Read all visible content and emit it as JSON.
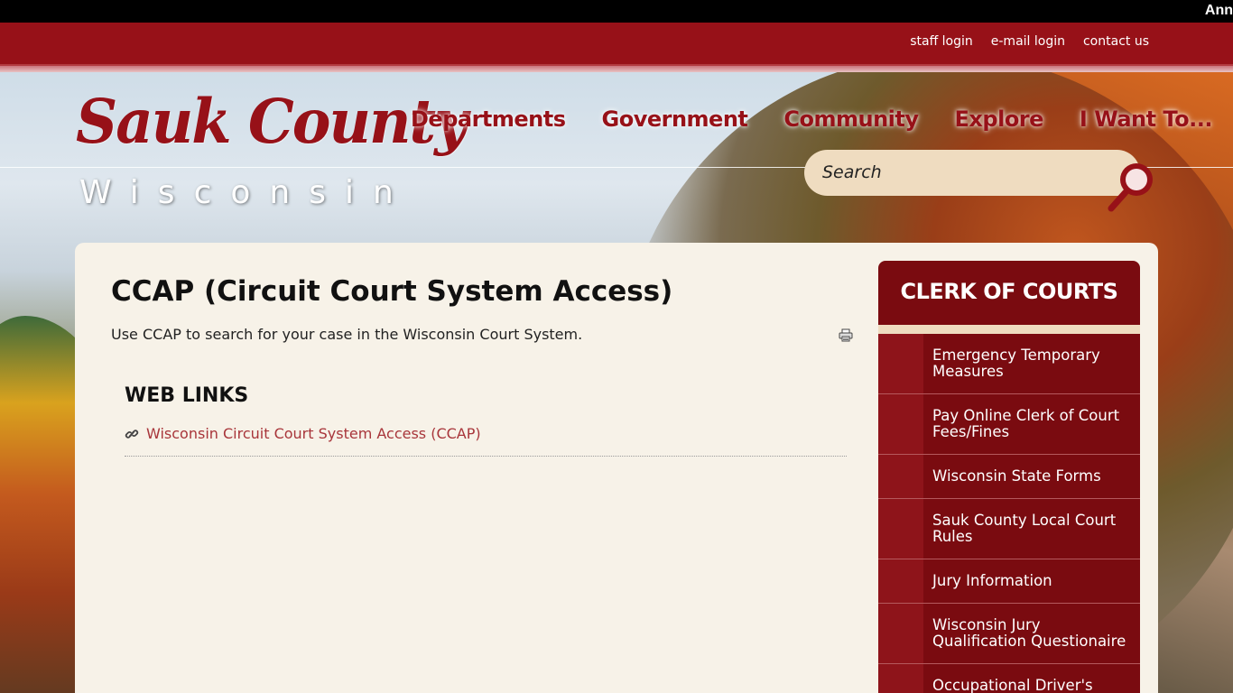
{
  "topbar": {
    "announcement": "Ann"
  },
  "utility": {
    "links": [
      "staff login",
      "e-mail login",
      "contact us"
    ]
  },
  "logo": {
    "main": "Sauk County",
    "sub": "Wisconsin"
  },
  "nav": {
    "items": [
      "Departments",
      "Government",
      "Community",
      "Explore",
      "I Want To..."
    ]
  },
  "search": {
    "placeholder": "Search"
  },
  "page": {
    "title": "CCAP (Circuit Court System Access)",
    "intro": "Use CCAP to search for your case in the Wisconsin Court System.",
    "weblinks_title": "WEB LINKS",
    "weblink": "Wisconsin Circuit Court System Access (CCAP)"
  },
  "sidebar": {
    "title": "CLERK OF COURTS",
    "items": [
      "Emergency Temporary Measures",
      "Pay Online Clerk of Court Fees/Fines",
      "Wisconsin State Forms",
      "Sauk County Local Court Rules",
      "Jury Information",
      "Wisconsin Jury Qualification Questionaire",
      "Occupational Driver's"
    ]
  },
  "colors": {
    "brand_red": "#971118",
    "dark_red": "#7a0b10",
    "panel": "#f7f2e8",
    "search_bg": "#efdcc0",
    "link": "#a8353a"
  }
}
